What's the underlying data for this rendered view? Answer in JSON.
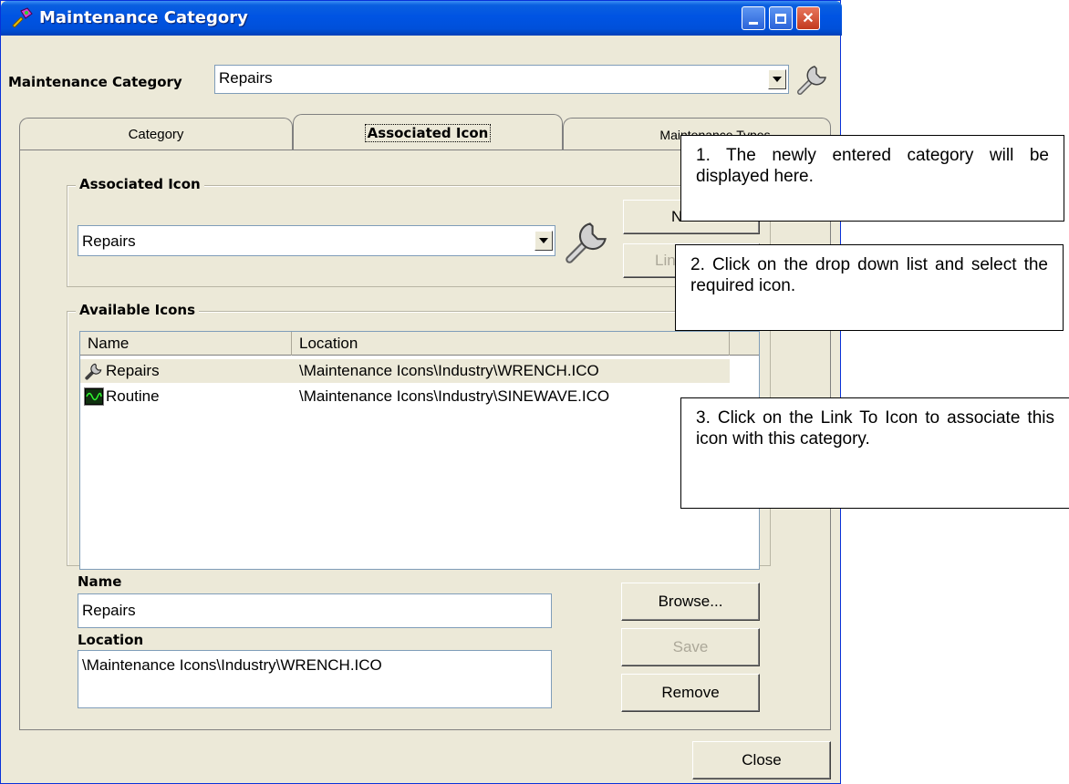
{
  "window": {
    "title": "Maintenance Category"
  },
  "header": {
    "category_label": "Maintenance Category",
    "category_value": "Repairs"
  },
  "tabs": [
    {
      "label": "Category"
    },
    {
      "label": "Associated Icon"
    },
    {
      "label": "Maintenance Types"
    }
  ],
  "associated_icon": {
    "group_title": "Associated Icon",
    "combo_value": "Repairs",
    "new_button": "New",
    "link_button": "Link To Icon"
  },
  "available_icons": {
    "group_title": "Available Icons",
    "columns": [
      "Name",
      "Location"
    ],
    "rows": [
      {
        "name": "Repairs",
        "location": "\\Maintenance Icons\\Industry\\WRENCH.ICO",
        "icon": "wrench-icon"
      },
      {
        "name": "Routine",
        "location": "\\Maintenance Icons\\Industry\\SINEWAVE.ICO",
        "icon": "sinewave-icon"
      }
    ]
  },
  "details": {
    "name_label": "Name",
    "name_value": "Repairs",
    "location_label": "Location",
    "location_value": "\\Maintenance Icons\\Industry\\WRENCH.ICO",
    "browse_button": "Browse...",
    "save_button": "Save",
    "remove_button": "Remove"
  },
  "footer": {
    "close_button": "Close"
  },
  "callouts": [
    "1. The newly entered category will be displayed here.",
    "2. Click on the drop down list and select the required icon.",
    "3. Click on the Link To Icon to associate this icon with this category."
  ],
  "colors": {
    "titlebar": "#0054e3",
    "window_bg": "#ece9d8",
    "selection": "#ece9d8"
  }
}
